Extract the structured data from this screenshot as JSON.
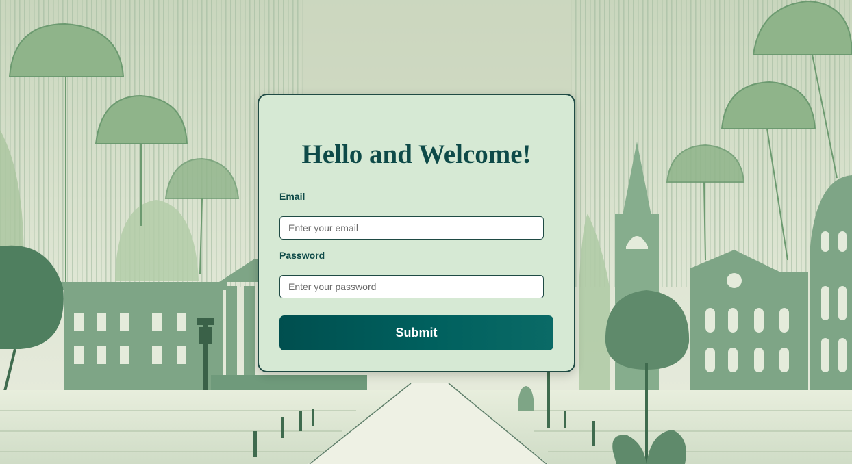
{
  "form": {
    "title": "Hello and Welcome!",
    "email_label": "Email",
    "email_placeholder": "Enter your email",
    "password_label": "Password",
    "password_placeholder": "Enter your password",
    "submit_label": "Submit"
  },
  "colors": {
    "card_background": "#d6e9d4",
    "accent": "#0e4a48",
    "button": "#005a58"
  }
}
